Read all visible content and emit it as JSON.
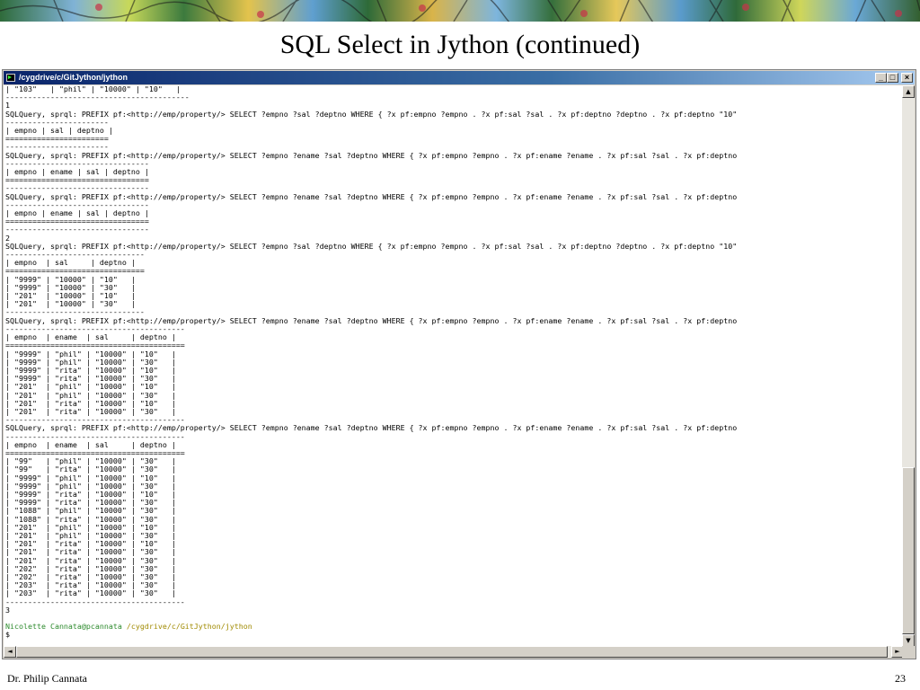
{
  "slide": {
    "title": "SQL Select in Jython (continued)",
    "footer_author": "Dr. Philip Cannata",
    "page_number": "23"
  },
  "window": {
    "title": "/cygdrive/c/GitJython/jython",
    "minimize_label": "_",
    "maximize_label": "□",
    "close_label": "×"
  },
  "scroll": {
    "up": "▲",
    "down": "▼",
    "left": "◄",
    "right": "►"
  },
  "terminal": {
    "output": "| \"103\"   | \"phil\" | \"10000\" | \"10\"   |\n-----------------------------------------\n1\nSQLQuery, sprql: PREFIX pf:<http://emp/property/> SELECT ?empno ?sal ?deptno WHERE { ?x pf:empno ?empno . ?x pf:sal ?sal . ?x pf:deptno ?deptno . ?x pf:deptno \"10\"\n-----------------------\n| empno | sal | deptno |\n=======================\n-----------------------\nSQLQuery, sprql: PREFIX pf:<http://emp/property/> SELECT ?empno ?ename ?sal ?deptno WHERE { ?x pf:empno ?empno . ?x pf:ename ?ename . ?x pf:sal ?sal . ?x pf:deptno\n--------------------------------\n| empno | ename | sal | deptno |\n================================\n--------------------------------\nSQLQuery, sprql: PREFIX pf:<http://emp/property/> SELECT ?empno ?ename ?sal ?deptno WHERE { ?x pf:empno ?empno . ?x pf:ename ?ename . ?x pf:sal ?sal . ?x pf:deptno\n--------------------------------\n| empno | ename | sal | deptno |\n================================\n--------------------------------\n2\nSQLQuery, sprql: PREFIX pf:<http://emp/property/> SELECT ?empno ?sal ?deptno WHERE { ?x pf:empno ?empno . ?x pf:sal ?sal . ?x pf:deptno ?deptno . ?x pf:deptno \"10\"\n-------------------------------\n| empno  | sal     | deptno |\n===============================\n| \"9999\" | \"10000\" | \"10\"   |\n| \"9999\" | \"10000\" | \"30\"   |\n| \"201\"  | \"10000\" | \"10\"   |\n| \"201\"  | \"10000\" | \"30\"   |\n-------------------------------\nSQLQuery, sprql: PREFIX pf:<http://emp/property/> SELECT ?empno ?ename ?sal ?deptno WHERE { ?x pf:empno ?empno . ?x pf:ename ?ename . ?x pf:sal ?sal . ?x pf:deptno\n----------------------------------------\n| empno  | ename  | sal     | deptno |\n========================================\n| \"9999\" | \"phil\" | \"10000\" | \"10\"   |\n| \"9999\" | \"phil\" | \"10000\" | \"30\"   |\n| \"9999\" | \"rita\" | \"10000\" | \"10\"   |\n| \"9999\" | \"rita\" | \"10000\" | \"30\"   |\n| \"201\"  | \"phil\" | \"10000\" | \"10\"   |\n| \"201\"  | \"phil\" | \"10000\" | \"30\"   |\n| \"201\"  | \"rita\" | \"10000\" | \"10\"   |\n| \"201\"  | \"rita\" | \"10000\" | \"30\"   |\n----------------------------------------\nSQLQuery, sprql: PREFIX pf:<http://emp/property/> SELECT ?empno ?ename ?sal ?deptno WHERE { ?x pf:empno ?empno . ?x pf:ename ?ename . ?x pf:sal ?sal . ?x pf:deptno\n----------------------------------------\n| empno  | ename  | sal     | deptno |\n========================================\n| \"99\"   | \"phil\" | \"10000\" | \"30\"   |\n| \"99\"   | \"rita\" | \"10000\" | \"30\"   |\n| \"9999\" | \"phil\" | \"10000\" | \"10\"   |\n| \"9999\" | \"phil\" | \"10000\" | \"30\"   |\n| \"9999\" | \"rita\" | \"10000\" | \"10\"   |\n| \"9999\" | \"rita\" | \"10000\" | \"30\"   |\n| \"1088\" | \"phil\" | \"10000\" | \"30\"   |\n| \"1088\" | \"rita\" | \"10000\" | \"30\"   |\n| \"201\"  | \"phil\" | \"10000\" | \"10\"   |\n| \"201\"  | \"phil\" | \"10000\" | \"30\"   |\n| \"201\"  | \"rita\" | \"10000\" | \"10\"   |\n| \"201\"  | \"rita\" | \"10000\" | \"30\"   |\n| \"201\"  | \"rita\" | \"10000\" | \"30\"   |\n| \"202\"  | \"rita\" | \"10000\" | \"30\"   |\n| \"202\"  | \"rita\" | \"10000\" | \"30\"   |\n| \"203\"  | \"rita\" | \"10000\" | \"30\"   |\n| \"203\"  | \"rita\" | \"10000\" | \"30\"   |\n----------------------------------------\n3\n",
    "prompt_user": "Nicolette Cannata@pcannata",
    "prompt_path": "/cygdrive/c/GitJython/jython",
    "prompt_symbol": "$"
  }
}
